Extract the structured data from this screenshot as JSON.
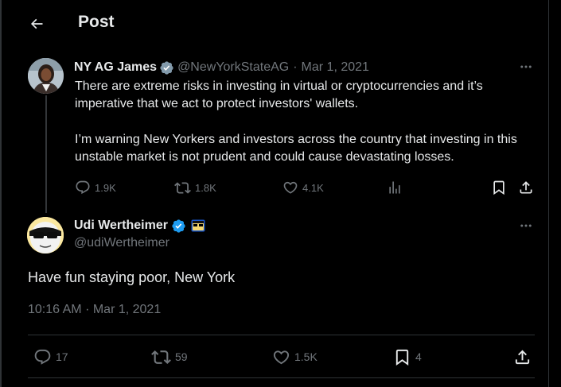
{
  "header": {
    "title": "Post",
    "back_icon": "arrow-left-icon"
  },
  "parent_tweet": {
    "name": "NY AG James",
    "handle": "@NewYorkStateAG",
    "separator": "·",
    "date": "Mar 1, 2021",
    "badge": "gray-verified-badge",
    "paragraph_1": "There are extreme risks in investing in virtual or cryptocurrencies and it’s imperative that we act to protect investors' wallets.",
    "paragraph_2": "I’m warning New Yorkers and investors across the country that investing in this unstable market is not prudent and could cause devastating losses.",
    "replies": "1.9K",
    "reposts": "1.8K",
    "likes": "4.1K"
  },
  "main_tweet": {
    "name": "Udi Wertheimer",
    "handle": "@udiWertheimer",
    "badge": "blue-verified-badge",
    "text": "Have fun staying poor, New York",
    "time": "10:16 AM",
    "separator": "·",
    "date": "Mar 1, 2021",
    "replies": "17",
    "reposts": "59",
    "likes": "1.5K",
    "bookmarks": "4"
  },
  "colors": {
    "background": "#000000",
    "text": "#e7e9ea",
    "muted": "#71767b",
    "verified_blue": "#1d9bf0",
    "gov_gray": "#829aab",
    "border": "#2f3336"
  }
}
